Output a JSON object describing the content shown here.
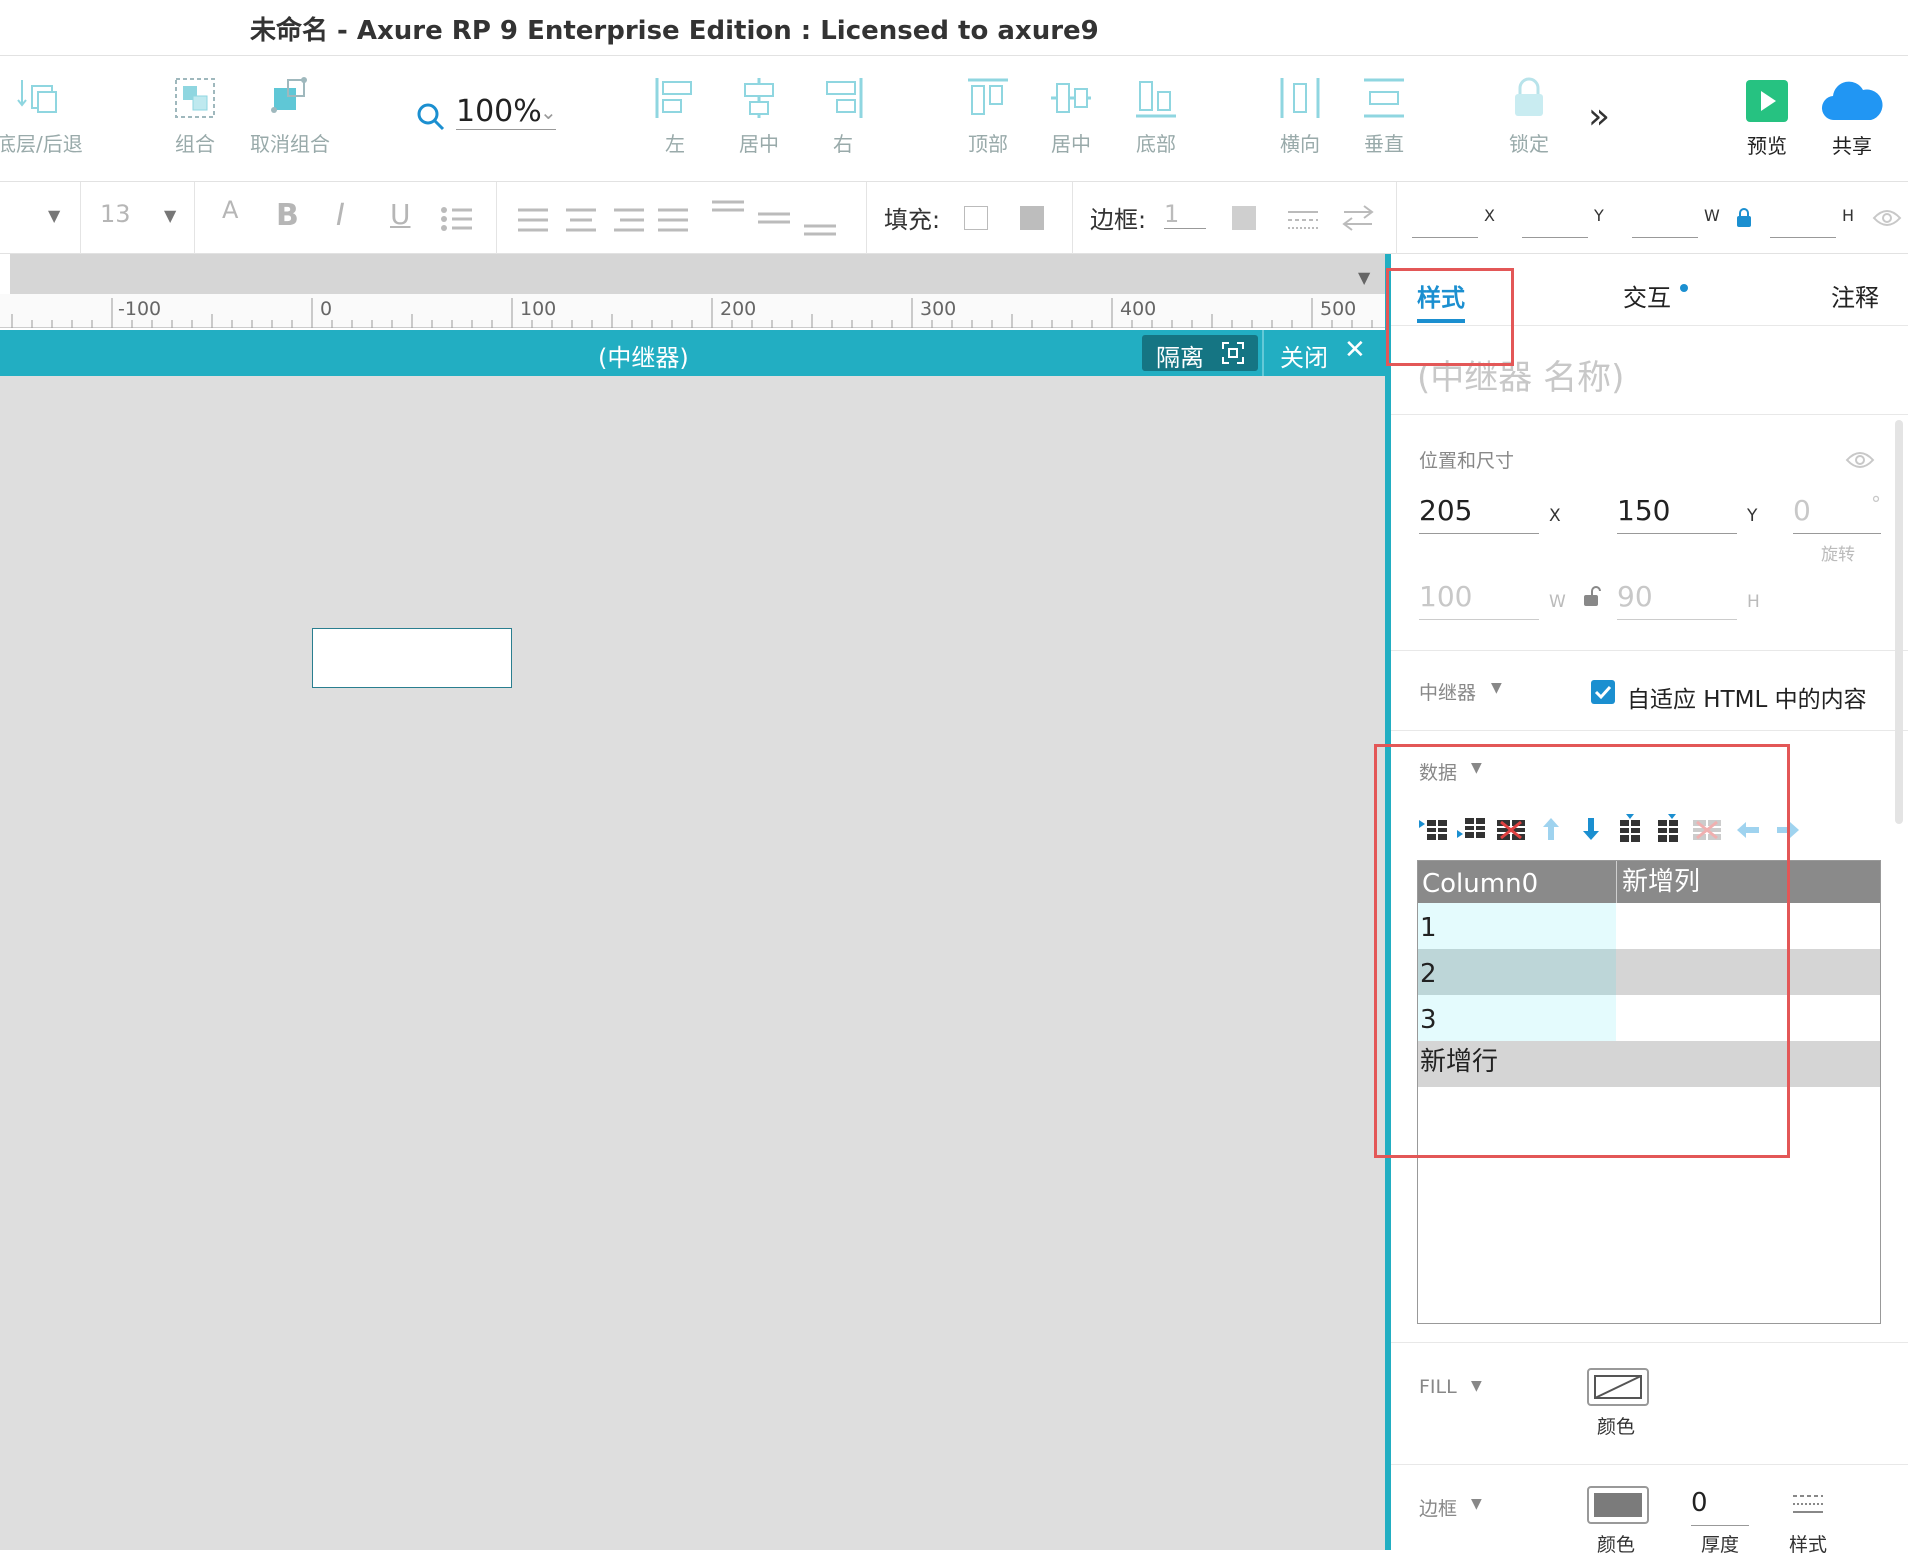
{
  "window": {
    "title": "未命名 - Axure RP 9 Enterprise Edition : Licensed to axure9"
  },
  "toolbar": {
    "bring_back_label": "底层/后退",
    "group_label": "组合",
    "ungroup_label": "取消组合",
    "zoom_value": "100%",
    "align_left_label": "左",
    "align_center_label": "居中",
    "align_right_label": "右",
    "align_top_label": "顶部",
    "align_middle_label": "居中",
    "align_bottom_label": "底部",
    "distribute_h_label": "横向",
    "distribute_v_label": "垂直",
    "lock_label": "锁定",
    "more_label": "»",
    "preview_label": "预览",
    "share_label": "共享",
    "accent_color": "#22aec2",
    "preview_color": "#26c281",
    "share_color": "#2196f3"
  },
  "format": {
    "font_size": "13",
    "fill_label": "填充:",
    "border_label": "边框:",
    "border_value": "1",
    "x_label": "X",
    "y_label": "Y",
    "w_label": "W",
    "h_label": "H"
  },
  "ruler": {
    "ticks": [
      "-100",
      "0",
      "100",
      "200",
      "300",
      "400",
      "500"
    ]
  },
  "repeater_bar": {
    "title": "(中继器)",
    "isolate_label": "隔离",
    "close_label": "关闭"
  },
  "inspector": {
    "tabs": [
      "样式",
      "交互",
      "注释"
    ],
    "active_tab": "样式",
    "name_placeholder": "(中继器 名称)",
    "position_size_title": "位置和尺寸",
    "x_value": "205",
    "x_label": "X",
    "y_value": "150",
    "y_label": "Y",
    "rotation_value": "0",
    "rotation_unit": "°",
    "rotation_label": "旋转",
    "w_value": "100",
    "w_label": "W",
    "h_value": "90",
    "h_label": "H",
    "repeater_section": "中继器",
    "fit_html_label": "自适应 HTML 中的内容",
    "fit_html_checked": true,
    "data_section": "数据",
    "table": {
      "columns": [
        "Column0",
        "新增列"
      ],
      "rows": [
        "1",
        "2",
        "3"
      ],
      "new_row_label": "新增行"
    },
    "fill_section": "FILL",
    "fill_color_label": "颜色",
    "border_section": "边框",
    "border_color_label": "颜色",
    "border_thickness_value": "0",
    "border_thickness_label": "厚度",
    "border_style_label": "样式",
    "highlight_color": "#e35757"
  }
}
